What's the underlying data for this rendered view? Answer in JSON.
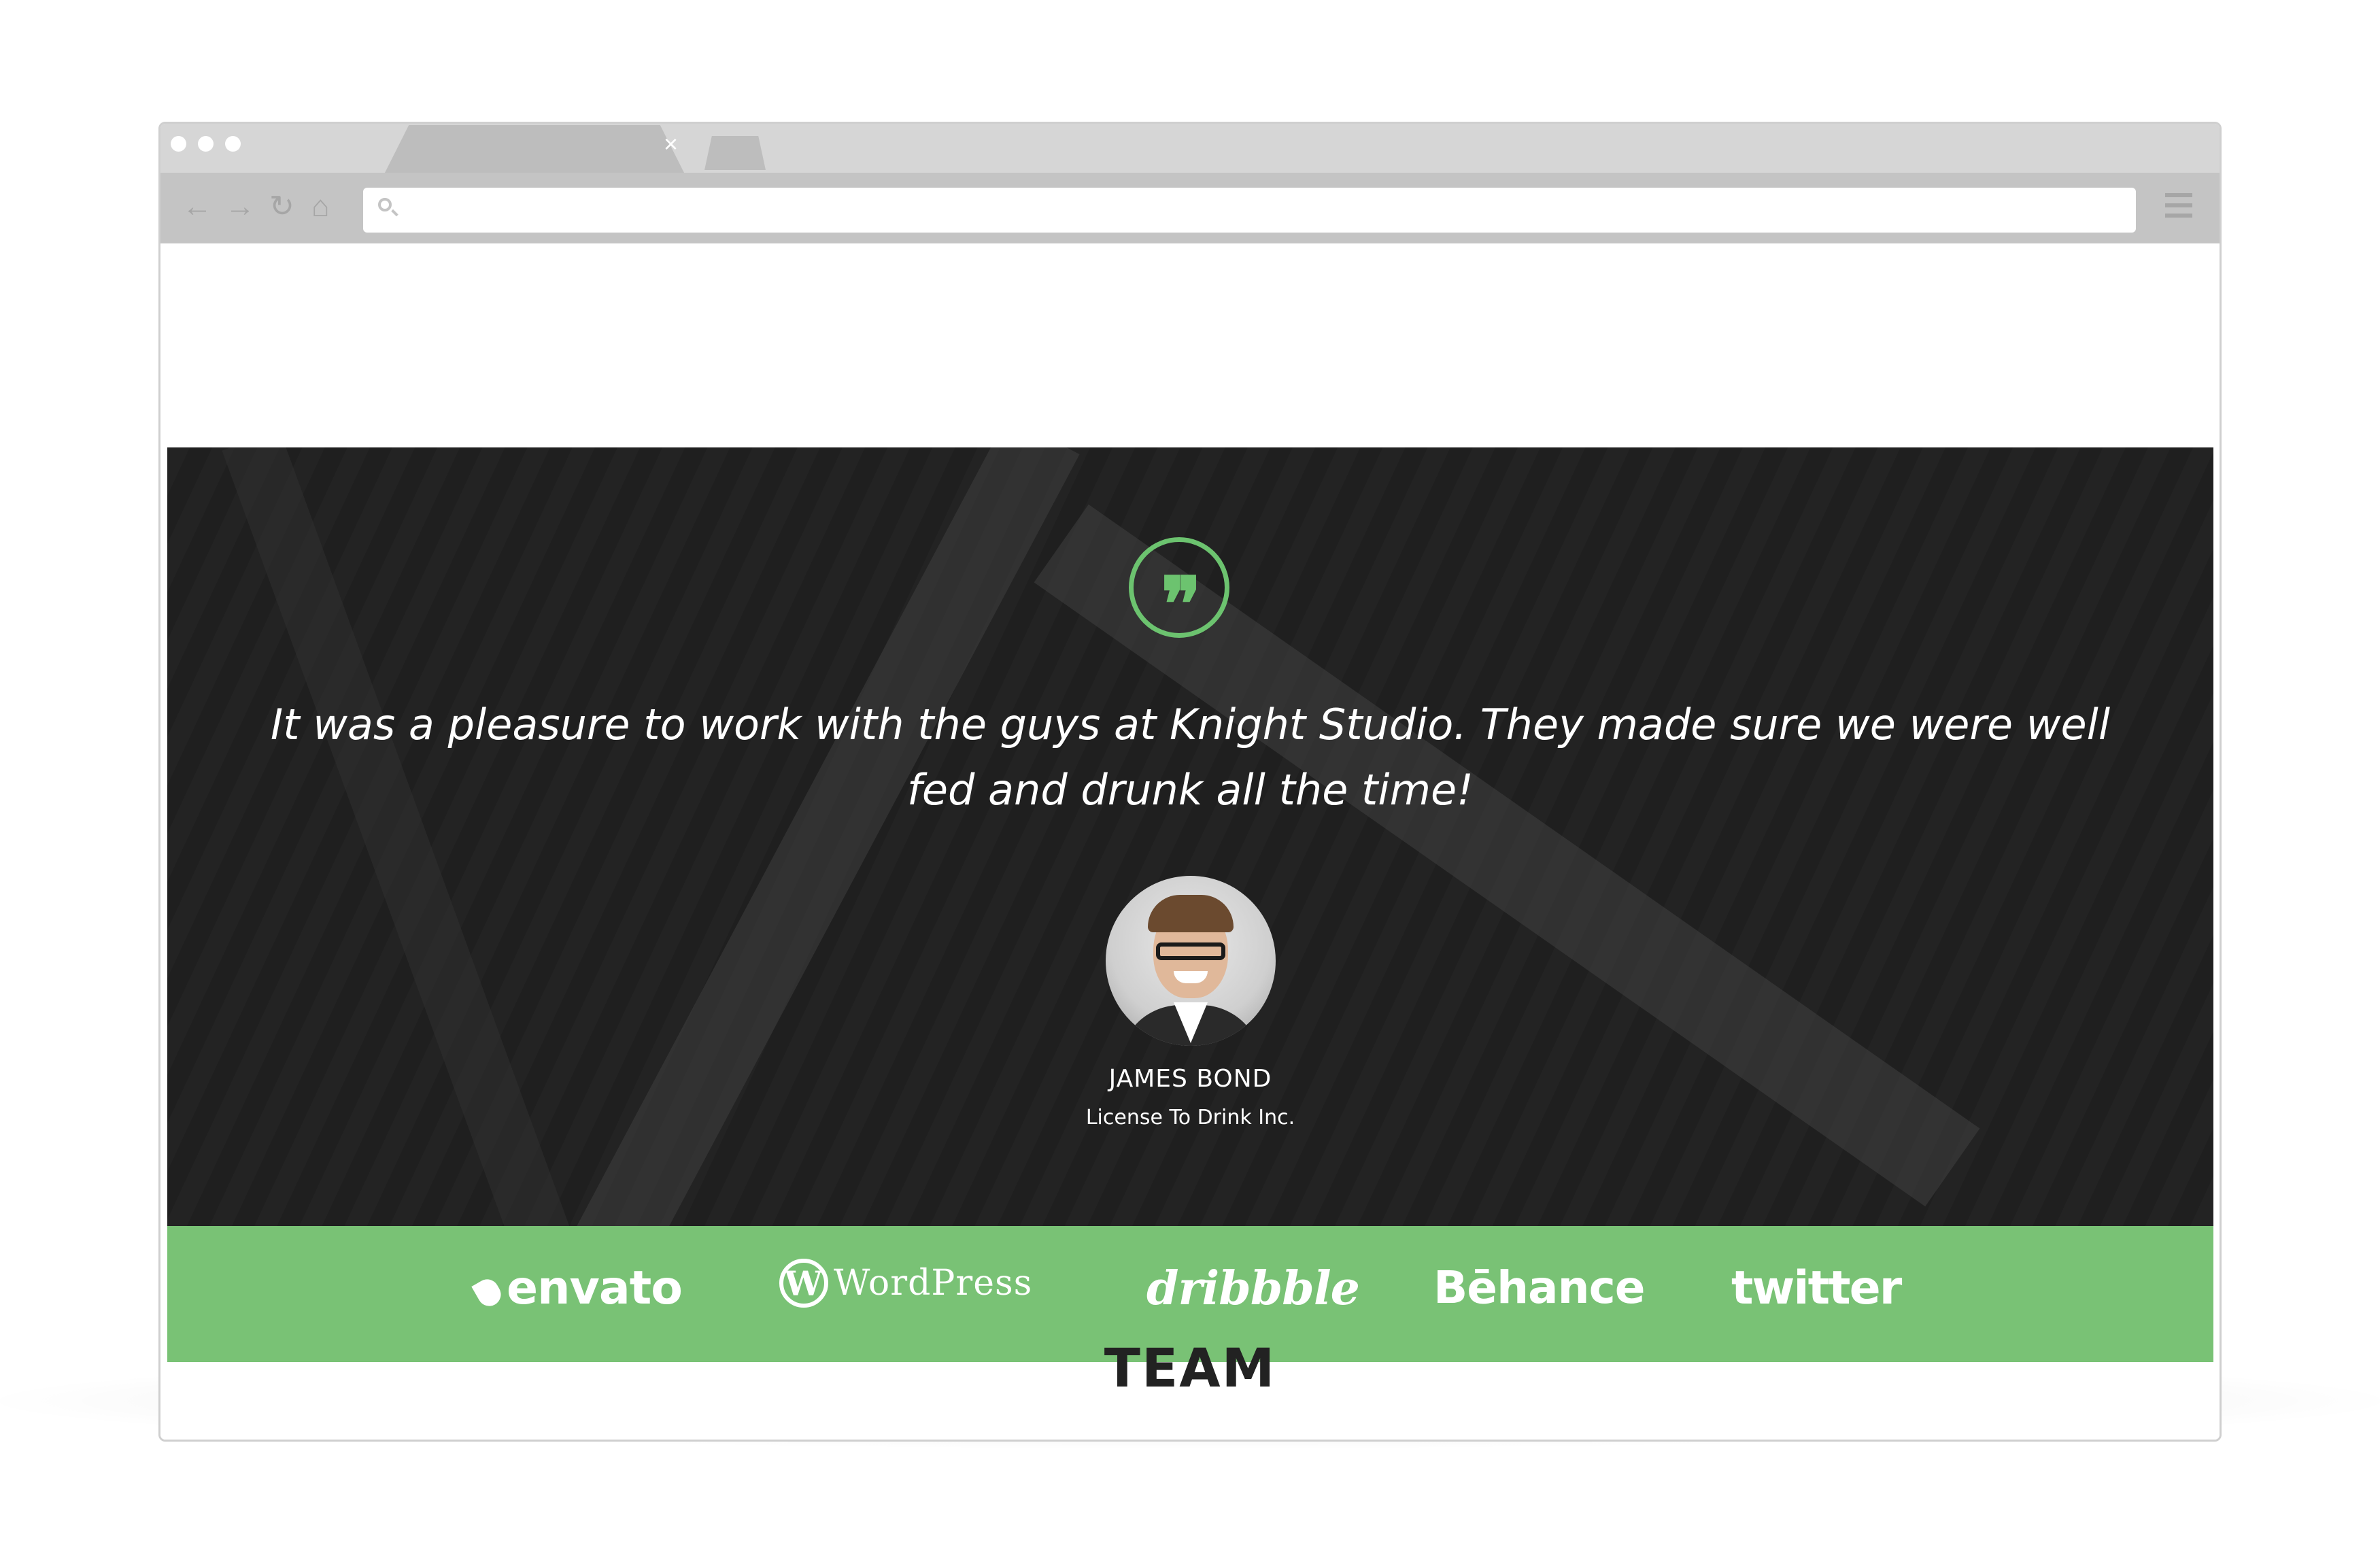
{
  "browser": {
    "tab_close_glyph": "×",
    "nav": {
      "back_glyph": "←",
      "forward_glyph": "→",
      "reload_glyph": "↻",
      "home_glyph": "⌂"
    },
    "url_placeholder": ""
  },
  "testimonial": {
    "quote_glyph": "❞",
    "quote": "It was a pleasure to work with the guys at Knight Studio. They made sure we were well fed and drunk all the time!",
    "author_name": "JAMES BOND",
    "author_company": "License To Drink Inc."
  },
  "clients": {
    "logos": [
      {
        "text": "envato",
        "icon": "leaf-icon"
      },
      {
        "text": "WordPress",
        "icon": "wordpress-icon",
        "icon_glyph": "W"
      },
      {
        "text": "dribbble"
      },
      {
        "text": "Bēhance"
      },
      {
        "text": "twitter"
      }
    ]
  },
  "team": {
    "title": "TEAM"
  },
  "colors": {
    "accent_green": "#79c275",
    "quote_ring": "#6cc36f",
    "hero_overlay": "#262626"
  }
}
